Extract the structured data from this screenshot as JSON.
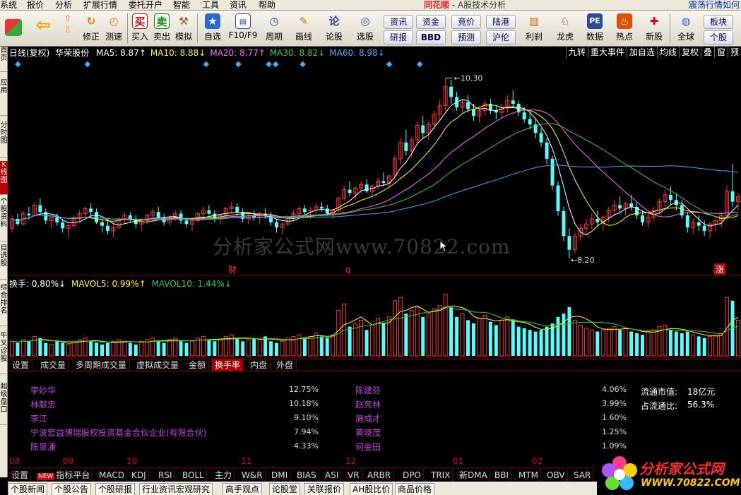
{
  "menu": {
    "items": [
      "系统",
      "报价",
      "分析",
      "扩展行情",
      "委托开户",
      "智能",
      "工具",
      "资讯",
      "帮助"
    ],
    "brand": "同花顺",
    "title": "- A股技术分析",
    "right_text": "震荡行情如何"
  },
  "toolbar": {
    "buttons": [
      {
        "label": "修正",
        "icon": "refresh-icon"
      },
      {
        "label": "测速",
        "icon": "stopwatch-icon"
      },
      {
        "label": "买入",
        "icon": "buy-icon",
        "glyph": "买"
      },
      {
        "label": "卖出",
        "icon": "sell-icon",
        "glyph": "卖"
      },
      {
        "label": "模拟",
        "icon": "hammer-icon"
      },
      {
        "label": "自选",
        "icon": "star-icon"
      },
      {
        "label": "F10/F9",
        "icon": "f10-icon"
      },
      {
        "label": "周期",
        "icon": "clock-icon"
      },
      {
        "label": "画线",
        "icon": "pencil-icon"
      },
      {
        "label": "论股",
        "icon": "discuss-icon",
        "glyph": "论"
      },
      {
        "label": "选股",
        "icon": "select-stock-icon"
      },
      {
        "label": "利刹",
        "icon": "tool-icon"
      },
      {
        "label": "龙虎",
        "icon": "dragon-icon"
      },
      {
        "label": "数据",
        "icon": "pe-icon",
        "glyph": "PE"
      },
      {
        "label": "热点",
        "icon": "hot-icon"
      },
      {
        "label": "新股",
        "icon": "new-stock-icon"
      },
      {
        "label": "全球",
        "icon": "globe-icon"
      }
    ],
    "boxes": [
      "资讯",
      "资金",
      "竞价",
      "陆港",
      "研报",
      "BBD",
      "预测",
      "沪伦",
      "板块",
      "个股"
    ]
  },
  "sidebar": [
    "首页",
    "应用",
    "分时图",
    "K线图",
    "个股资料",
    "自选股",
    "综合排名",
    "牛叉诊股",
    "超级盘口"
  ],
  "chart": {
    "period": "日线(复权)",
    "stock": "华荣股份",
    "ma": [
      {
        "label": "MA5: 8.87",
        "arrow": "↑",
        "color": "#ffffff"
      },
      {
        "label": "MA10: 8.88",
        "arrow": "↓",
        "color": "#ffff00"
      },
      {
        "label": "MA20: 8.77",
        "arrow": "↑",
        "color": "#ff66ff"
      },
      {
        "label": "MA30: 8.82",
        "arrow": "↓",
        "color": "#33cc33"
      },
      {
        "label": "MA60: 8.98",
        "arrow": "↓",
        "color": "#33aaff"
      }
    ],
    "right_buttons": [
      "九转",
      "重大事件",
      "加自选",
      "均线",
      "复权",
      "叠",
      "窗",
      "预"
    ],
    "high_label": "10.30",
    "low_label": "8.20",
    "markers": [
      "财",
      "q",
      "涨"
    ],
    "sub_legend": [
      {
        "label": "换手: 0.80%",
        "arrow": "↓",
        "color": "#ffffff"
      },
      {
        "label": "MAVOL5: 0.99%",
        "arrow": "↑",
        "color": "#ffff00"
      },
      {
        "label": "MAVOL10: 1.44%",
        "arrow": "↓",
        "color": "#33cc33"
      }
    ],
    "watermark": "分析家公式网www.70822.com"
  },
  "tabs": [
    "设置",
    "成交量",
    "多周期成交量",
    "虚拟成交量",
    "金额",
    "换手率",
    "内盘",
    "外盘"
  ],
  "active_tab": "换手率",
  "holders": {
    "left": [
      {
        "name": "李妙华",
        "pct": "12.75%"
      },
      {
        "name": "林献忠",
        "pct": "10.18%"
      },
      {
        "name": "李江",
        "pct": "9.10%"
      },
      {
        "name": "宁波宏益博瑞股权投资基金合伙企业(有限合伙)",
        "pct": "7.94%"
      },
      {
        "name": "陈景潘",
        "pct": "4.33%"
      }
    ],
    "right": [
      {
        "name": "陈建芬",
        "pct": "4.06%"
      },
      {
        "name": "赵亮林",
        "pct": "3.99%"
      },
      {
        "name": "施成才",
        "pct": "1.60%"
      },
      {
        "name": "黄晓茂",
        "pct": "1.25%"
      },
      {
        "name": "何金田",
        "pct": "1.09%"
      }
    ],
    "float_mv_label": "流通市值:",
    "float_mv_value": "18亿元",
    "float_ratio_label": "占流通比:",
    "float_ratio_value": "56.3%"
  },
  "bottom_axis": [
    "08",
    "09",
    "10",
    "11",
    "12",
    "01",
    "02"
  ],
  "indicators": [
    "设置",
    "指标平台",
    "MACD",
    "KDJ",
    "RSI",
    "BOLL",
    "主力",
    "W&R",
    "DMI",
    "BIAS",
    "ASI",
    "VR",
    "ARBR",
    "DPO",
    "TRIX",
    "新DMA",
    "BBI",
    "MTM",
    "OBV",
    "SAR"
  ],
  "indicator_new_badge": "NEW",
  "news_tabs": [
    "个股新闻",
    "个股公告",
    "个股研报",
    "行业资讯宏观研究",
    "高手观点",
    "论股堂",
    "关联报价",
    "AH股比价",
    "商品价格"
  ],
  "logo": {
    "line1": "分析家公式网",
    "line2": "WWW.70822.COM"
  },
  "chart_data": {
    "type": "candlestick",
    "note_x": "daily candles from Aug to Feb",
    "y_high": 10.3,
    "y_low": 8.2,
    "candles": [
      [
        8.55,
        8.7,
        8.5,
        8.66
      ],
      [
        8.66,
        8.72,
        8.58,
        8.6
      ],
      [
        8.6,
        8.75,
        8.58,
        8.72
      ],
      [
        8.72,
        8.8,
        8.65,
        8.7
      ],
      [
        8.7,
        8.85,
        8.68,
        8.82
      ],
      [
        8.82,
        8.9,
        8.7,
        8.74
      ],
      [
        8.74,
        8.78,
        8.6,
        8.64
      ],
      [
        8.64,
        8.7,
        8.55,
        8.68
      ],
      [
        8.68,
        8.72,
        8.58,
        8.62
      ],
      [
        8.62,
        8.66,
        8.5,
        8.55
      ],
      [
        8.55,
        8.62,
        8.45,
        8.58
      ],
      [
        8.58,
        8.7,
        8.55,
        8.66
      ],
      [
        8.66,
        8.76,
        8.62,
        8.72
      ],
      [
        8.72,
        8.8,
        8.68,
        8.78
      ],
      [
        8.78,
        8.84,
        8.7,
        8.74
      ],
      [
        8.74,
        8.78,
        8.6,
        8.62
      ],
      [
        8.62,
        8.66,
        8.5,
        8.58
      ],
      [
        8.58,
        8.64,
        8.48,
        8.52
      ],
      [
        8.52,
        8.6,
        8.45,
        8.56
      ],
      [
        8.56,
        8.68,
        8.54,
        8.66
      ],
      [
        8.66,
        8.74,
        8.6,
        8.7
      ],
      [
        8.7,
        8.74,
        8.62,
        8.65
      ],
      [
        8.65,
        8.7,
        8.55,
        8.6
      ],
      [
        8.6,
        8.66,
        8.52,
        8.64
      ],
      [
        8.64,
        8.72,
        8.6,
        8.7
      ],
      [
        8.7,
        8.78,
        8.66,
        8.74
      ],
      [
        8.74,
        8.8,
        8.66,
        8.68
      ],
      [
        8.68,
        8.72,
        8.58,
        8.62
      ],
      [
        8.62,
        8.7,
        8.58,
        8.68
      ],
      [
        8.68,
        8.76,
        8.64,
        8.72
      ],
      [
        8.72,
        8.76,
        8.6,
        8.64
      ],
      [
        8.64,
        8.68,
        8.56,
        8.6
      ],
      [
        8.6,
        8.66,
        8.52,
        8.64
      ],
      [
        8.64,
        8.74,
        8.62,
        8.72
      ],
      [
        8.72,
        8.8,
        8.68,
        8.76
      ],
      [
        8.76,
        8.82,
        8.7,
        8.72
      ],
      [
        8.72,
        8.76,
        8.62,
        8.66
      ],
      [
        8.66,
        8.72,
        8.6,
        8.7
      ],
      [
        8.7,
        8.8,
        8.68,
        8.78
      ],
      [
        8.78,
        8.86,
        8.72,
        8.8
      ],
      [
        8.8,
        8.84,
        8.7,
        8.74
      ],
      [
        8.74,
        8.78,
        8.62,
        8.66
      ],
      [
        8.66,
        8.72,
        8.6,
        8.7
      ],
      [
        8.7,
        8.76,
        8.64,
        8.68
      ],
      [
        8.68,
        8.74,
        8.6,
        8.72
      ],
      [
        8.72,
        8.78,
        8.66,
        8.7
      ],
      [
        8.7,
        8.74,
        8.58,
        8.62
      ],
      [
        8.62,
        8.66,
        8.5,
        8.56
      ],
      [
        8.56,
        8.62,
        8.48,
        8.6
      ],
      [
        8.6,
        8.7,
        8.58,
        8.68
      ],
      [
        8.68,
        8.76,
        8.64,
        8.72
      ],
      [
        8.72,
        8.8,
        8.68,
        8.78
      ],
      [
        8.78,
        8.82,
        8.7,
        8.74
      ],
      [
        8.74,
        8.8,
        8.66,
        8.76
      ],
      [
        8.76,
        8.84,
        8.72,
        8.8
      ],
      [
        8.8,
        8.86,
        8.74,
        8.78
      ],
      [
        8.78,
        8.82,
        8.7,
        8.72
      ],
      [
        8.72,
        8.78,
        8.66,
        8.76
      ],
      [
        8.76,
        8.92,
        8.74,
        8.9
      ],
      [
        8.9,
        9.05,
        8.86,
        9.0
      ],
      [
        9.0,
        9.1,
        8.92,
        8.96
      ],
      [
        8.96,
        9.04,
        8.88,
        9.02
      ],
      [
        9.02,
        9.1,
        8.96,
        9.06
      ],
      [
        9.06,
        9.12,
        8.96,
        8.98
      ],
      [
        8.98,
        9.06,
        8.9,
        9.04
      ],
      [
        9.04,
        9.14,
        9.0,
        9.1
      ],
      [
        9.1,
        9.2,
        9.04,
        9.08
      ],
      [
        9.08,
        9.18,
        9.02,
        9.16
      ],
      [
        9.16,
        9.4,
        9.12,
        9.36
      ],
      [
        9.36,
        9.6,
        9.3,
        9.55
      ],
      [
        9.55,
        9.7,
        9.4,
        9.45
      ],
      [
        9.45,
        9.62,
        9.38,
        9.58
      ],
      [
        9.58,
        9.8,
        9.52,
        9.75
      ],
      [
        9.75,
        9.86,
        9.6,
        9.66
      ],
      [
        9.66,
        9.8,
        9.58,
        9.76
      ],
      [
        9.76,
        9.92,
        9.7,
        9.88
      ],
      [
        9.88,
        10.05,
        9.8,
        9.98
      ],
      [
        9.98,
        10.3,
        9.92,
        10.2
      ],
      [
        10.2,
        10.28,
        10.0,
        10.08
      ],
      [
        10.08,
        10.14,
        9.92,
        9.96
      ],
      [
        9.96,
        10.06,
        9.88,
        10.02
      ],
      [
        10.02,
        10.1,
        9.9,
        9.94
      ],
      [
        9.94,
        10.0,
        9.8,
        9.86
      ],
      [
        9.86,
        9.96,
        9.78,
        9.92
      ],
      [
        9.92,
        10.04,
        9.86,
        10.0
      ],
      [
        10.0,
        10.06,
        9.88,
        9.92
      ],
      [
        9.92,
        9.98,
        9.82,
        9.9
      ],
      [
        9.9,
        10.0,
        9.84,
        9.96
      ],
      [
        9.96,
        10.1,
        9.9,
        10.04
      ],
      [
        10.04,
        10.16,
        9.96,
        10.0
      ],
      [
        10.0,
        10.04,
        9.86,
        9.9
      ],
      [
        9.9,
        9.96,
        9.78,
        9.82
      ],
      [
        9.82,
        9.9,
        9.7,
        9.76
      ],
      [
        9.76,
        9.82,
        9.6,
        9.66
      ],
      [
        9.66,
        9.72,
        9.5,
        9.55
      ],
      [
        9.55,
        9.6,
        9.3,
        9.36
      ],
      [
        9.36,
        9.4,
        9.0,
        9.05
      ],
      [
        9.05,
        9.1,
        8.7,
        8.75
      ],
      [
        8.75,
        8.8,
        8.4,
        8.46
      ],
      [
        8.46,
        8.55,
        8.2,
        8.3
      ],
      [
        8.3,
        8.5,
        8.26,
        8.46
      ],
      [
        8.46,
        8.6,
        8.4,
        8.55
      ],
      [
        8.55,
        8.66,
        8.48,
        8.6
      ],
      [
        8.6,
        8.72,
        8.54,
        8.66
      ],
      [
        8.66,
        8.76,
        8.58,
        8.62
      ],
      [
        8.62,
        8.7,
        8.52,
        8.68
      ],
      [
        8.68,
        8.8,
        8.62,
        8.76
      ],
      [
        8.76,
        8.88,
        8.7,
        8.82
      ],
      [
        8.82,
        8.92,
        8.74,
        8.78
      ],
      [
        8.78,
        8.86,
        8.7,
        8.84
      ],
      [
        8.84,
        8.94,
        8.76,
        8.8
      ],
      [
        8.8,
        8.86,
        8.66,
        8.7
      ],
      [
        8.7,
        8.76,
        8.58,
        8.62
      ],
      [
        8.62,
        8.72,
        8.56,
        8.68
      ],
      [
        8.68,
        8.8,
        8.64,
        8.76
      ],
      [
        8.76,
        8.9,
        8.72,
        8.86
      ],
      [
        8.86,
        9.0,
        8.8,
        8.94
      ],
      [
        8.94,
        9.04,
        8.82,
        8.88
      ],
      [
        8.88,
        8.96,
        8.76,
        8.82
      ],
      [
        8.82,
        8.88,
        8.66,
        8.7
      ],
      [
        8.7,
        8.74,
        8.5,
        8.56
      ],
      [
        8.56,
        8.66,
        8.48,
        8.62
      ],
      [
        8.62,
        8.7,
        8.52,
        8.58
      ],
      [
        8.58,
        8.64,
        8.46,
        8.52
      ],
      [
        8.52,
        8.62,
        8.44,
        8.6
      ],
      [
        8.6,
        8.68,
        8.52,
        8.64
      ],
      [
        8.64,
        8.74,
        8.56,
        8.7
      ],
      [
        8.7,
        9.05,
        8.66,
        8.98
      ],
      [
        8.98,
        9.3,
        8.8,
        8.86
      ],
      [
        8.86,
        8.96,
        8.76,
        8.92
      ]
    ],
    "turnover": [
      0.9,
      0.8,
      1.0,
      0.9,
      1.2,
      1.1,
      0.8,
      0.7,
      0.9,
      0.8,
      0.7,
      0.9,
      1.0,
      1.1,
      0.9,
      0.8,
      0.7,
      0.8,
      0.9,
      1.0,
      0.9,
      0.8,
      0.7,
      0.9,
      1.0,
      1.1,
      0.9,
      0.8,
      1.0,
      1.1,
      0.9,
      0.8,
      0.9,
      1.1,
      1.2,
      1.0,
      0.9,
      1.0,
      1.2,
      1.3,
      1.1,
      0.9,
      1.0,
      1.1,
      1.0,
      1.2,
      0.9,
      0.8,
      0.9,
      1.1,
      1.2,
      1.3,
      1.1,
      1.2,
      1.4,
      1.2,
      1.1,
      1.3,
      2.8,
      3.2,
      1.8,
      2.0,
      2.2,
      1.6,
      1.9,
      2.3,
      2.0,
      2.4,
      3.4,
      3.6,
      2.6,
      2.8,
      3.0,
      2.4,
      2.6,
      2.9,
      3.1,
      3.8,
      3.0,
      2.4,
      2.6,
      2.2,
      2.0,
      2.3,
      2.5,
      2.1,
      1.9,
      2.2,
      2.4,
      2.2,
      1.8,
      1.7,
      1.6,
      1.5,
      1.6,
      1.8,
      2.0,
      2.4,
      2.6,
      3.0,
      2.2,
      1.9,
      1.7,
      1.6,
      1.5,
      1.6,
      1.7,
      1.8,
      1.6,
      1.7,
      1.5,
      1.4,
      1.3,
      1.5,
      1.6,
      1.8,
      1.9,
      1.6,
      1.5,
      1.4,
      1.5,
      1.3,
      1.2,
      1.1,
      1.2,
      1.3,
      1.4,
      3.6,
      3.4,
      2.2
    ],
    "ma_lines": {
      "MA5": "#ffffff",
      "MA10": "#ffff00",
      "MA20": "#ff66ff",
      "MA30": "#33cc33",
      "MA60": "#33aaff"
    }
  }
}
